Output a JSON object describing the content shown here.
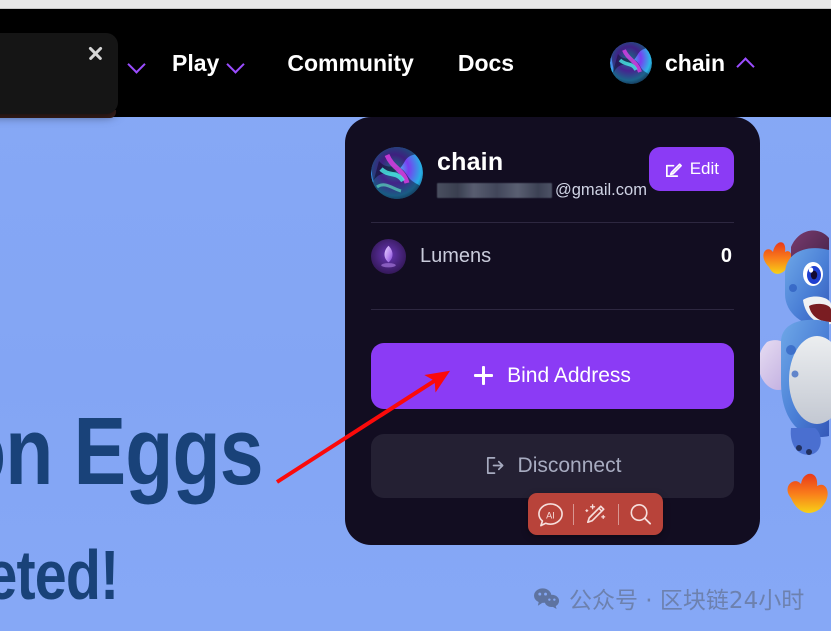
{
  "page": {
    "background_color": "#84a7f5",
    "hero_line_1": "on Eggs",
    "hero_line_2": "pleted!",
    "hero_color": "#194279"
  },
  "navbar": {
    "background_color": "#000000",
    "accent_color": "#9b4dff",
    "items": [
      {
        "label": "",
        "has_chevron": true,
        "chevron": "down"
      },
      {
        "label": "Play",
        "has_chevron": true,
        "chevron": "down"
      },
      {
        "label": "Community",
        "has_chevron": false
      },
      {
        "label": "Docs",
        "has_chevron": false
      }
    ],
    "account": {
      "name": "chain",
      "chevron": "up",
      "avatar_icon": "gradient-orb-avatar"
    }
  },
  "popup_panel": {
    "close_icon": "close-icon"
  },
  "account_card": {
    "background_color": "#120d21",
    "avatar_icon": "gradient-orb-avatar",
    "name": "chain",
    "email_visible_part": "@gmail.com",
    "email_redacted": true,
    "edit_button": {
      "label": "Edit",
      "icon": "pencil-square-icon",
      "color": "#8b3bf5"
    },
    "lumens": {
      "icon": "lumen-gem-icon",
      "label": "Lumens",
      "value": "0"
    },
    "bind_button": {
      "label": "Bind Address",
      "icon": "plus-icon",
      "color": "#8b3bf5"
    },
    "disconnect_button": {
      "label": "Disconnect",
      "icon": "logout-icon",
      "color": "#242033"
    }
  },
  "float_toolbar": {
    "background_color": "#b8433a",
    "buttons": [
      {
        "name": "ai-chat-icon",
        "label": "AI"
      },
      {
        "name": "magic-pen-icon",
        "label": ""
      },
      {
        "name": "search-icon",
        "label": ""
      }
    ]
  },
  "annotation": {
    "arrow_color": "#fb0a0a",
    "points_to": "Bind Address"
  },
  "watermark": {
    "icon": "wechat-icon",
    "text": "公众号 · 区块链24小时"
  }
}
